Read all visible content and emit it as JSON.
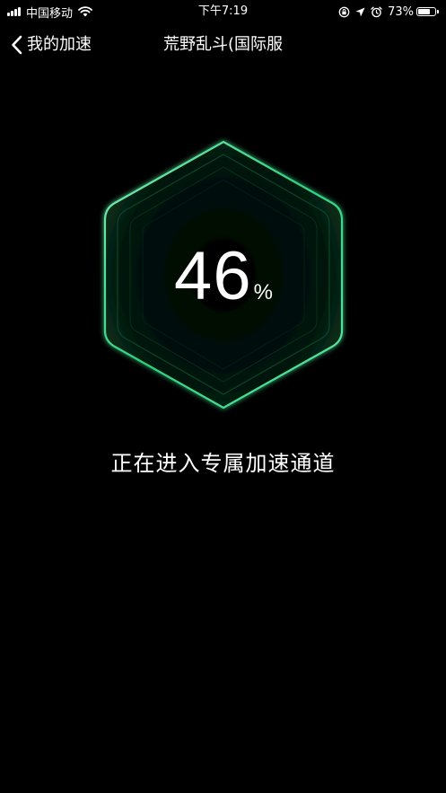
{
  "status_bar": {
    "carrier": "中国移动",
    "time": "下午7:19",
    "battery_text": "73%",
    "battery_level": 0.73,
    "icons": [
      "signal-icon",
      "wifi-icon",
      "rotation-lock-icon",
      "location-icon",
      "alarm-icon",
      "battery-icon"
    ]
  },
  "nav": {
    "back_label": "我的加速",
    "back_icon": "chevron-left-icon",
    "title": "荒野乱斗(国际服"
  },
  "progress": {
    "value": "46",
    "unit": "%",
    "fraction": 0.46
  },
  "message": "正在进入专属加速通道",
  "colors": {
    "background": "#000000",
    "accent": "#35d68a",
    "accent_glow": "#1f8f5c",
    "text": "#ffffff"
  }
}
